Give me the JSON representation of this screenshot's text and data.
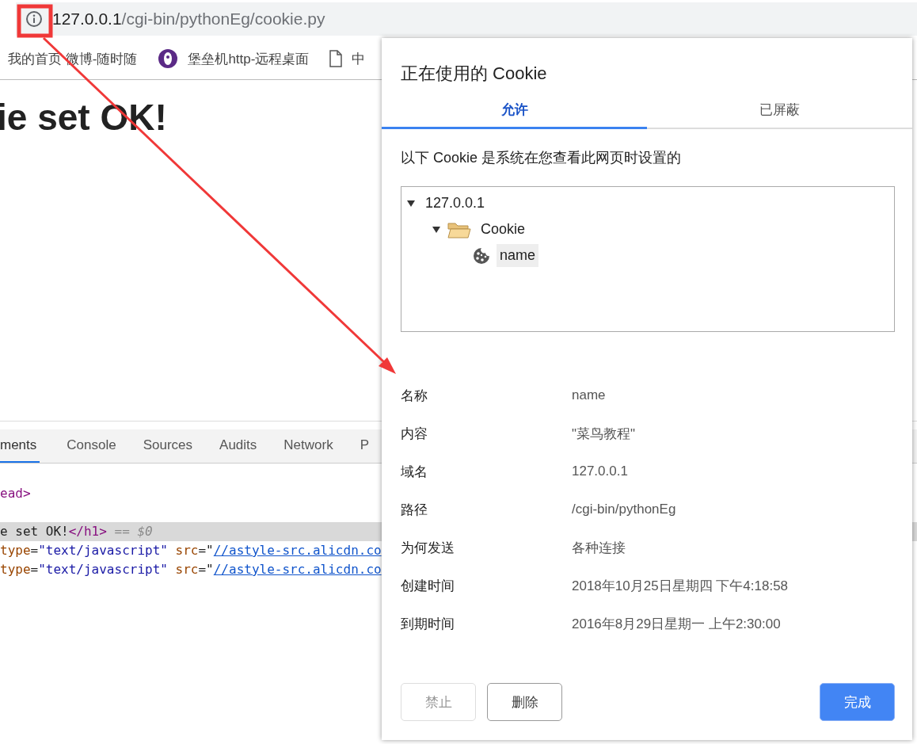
{
  "address_bar": {
    "host": "127.0.0.1",
    "path": "/cgi-bin/pythonEg/cookie.py"
  },
  "bookmarks": [
    {
      "label": "我的首页 微博-随时随",
      "kind": "none"
    },
    {
      "label": "堡垒机http-远程桌面",
      "kind": "logo"
    },
    {
      "label": "中",
      "kind": "page"
    }
  ],
  "page": {
    "heading": "ie set OK!"
  },
  "devtools": {
    "tabs": [
      {
        "label": "ments",
        "selected": true
      },
      {
        "label": "Console",
        "selected": false
      },
      {
        "label": "Sources",
        "selected": false
      },
      {
        "label": "Audits",
        "selected": false
      },
      {
        "label": "Network",
        "selected": false
      },
      {
        "label": "P",
        "selected": false
      }
    ],
    "code_lines": [
      {
        "selected": false,
        "segments": [
          {
            "kind": "tag",
            "text": "ead>"
          }
        ]
      },
      {
        "selected": true,
        "segments": [
          {
            "kind": "text",
            "text": "e set OK!"
          },
          {
            "kind": "tag",
            "text": "</h1>"
          },
          {
            "kind": "comment",
            "text": " == $0"
          }
        ]
      },
      {
        "selected": false,
        "segments": [
          {
            "kind": "attr",
            "text": "type"
          },
          {
            "kind": "text",
            "text": "="
          },
          {
            "kind": "value",
            "text": "\"text/javascript\""
          },
          {
            "kind": "attr",
            "text": " src"
          },
          {
            "kind": "text",
            "text": "=\""
          },
          {
            "kind": "link",
            "text": "//astyle-src.alicdn.co"
          }
        ]
      },
      {
        "selected": false,
        "segments": [
          {
            "kind": "attr",
            "text": "type"
          },
          {
            "kind": "text",
            "text": "="
          },
          {
            "kind": "value",
            "text": "\"text/javascript\""
          },
          {
            "kind": "attr",
            "text": " src"
          },
          {
            "kind": "text",
            "text": "=\""
          },
          {
            "kind": "link",
            "text": "//astyle-src.alicdn.co"
          }
        ]
      }
    ]
  },
  "dialog": {
    "title": "正在使用的 Cookie",
    "tabs": [
      {
        "label": "允许",
        "selected": true
      },
      {
        "label": "已屏蔽",
        "selected": false
      }
    ],
    "description": "以下 Cookie 是系统在您查看此网页时设置的",
    "tree": [
      {
        "label": "127.0.0.1",
        "expanded": true,
        "selected": false,
        "children": [
          {
            "label": "Cookie",
            "kind": "folder",
            "expanded": true,
            "selected": false,
            "children": [
              {
                "label": "name",
                "kind": "cookie",
                "selected": true
              }
            ]
          }
        ]
      }
    ],
    "details": [
      {
        "label": "名称",
        "value": "name"
      },
      {
        "label": "内容",
        "value": "\"菜鸟教程\""
      },
      {
        "label": "域名",
        "value": "127.0.0.1"
      },
      {
        "label": "路径",
        "value": "/cgi-bin/pythonEg"
      },
      {
        "label": "为何发送",
        "value": "各种连接"
      },
      {
        "label": "创建时间",
        "value": "2018年10月25日星期四 下午4:18:58"
      },
      {
        "label": "到期时间",
        "value": "2016年8月29日星期一 上午2:30:00"
      }
    ],
    "buttons": [
      {
        "label": "禁止",
        "kind": "secondary",
        "disabled": true
      },
      {
        "label": "删除",
        "kind": "secondary",
        "disabled": false
      },
      {
        "label": "完成",
        "kind": "primary",
        "disabled": false
      }
    ]
  }
}
